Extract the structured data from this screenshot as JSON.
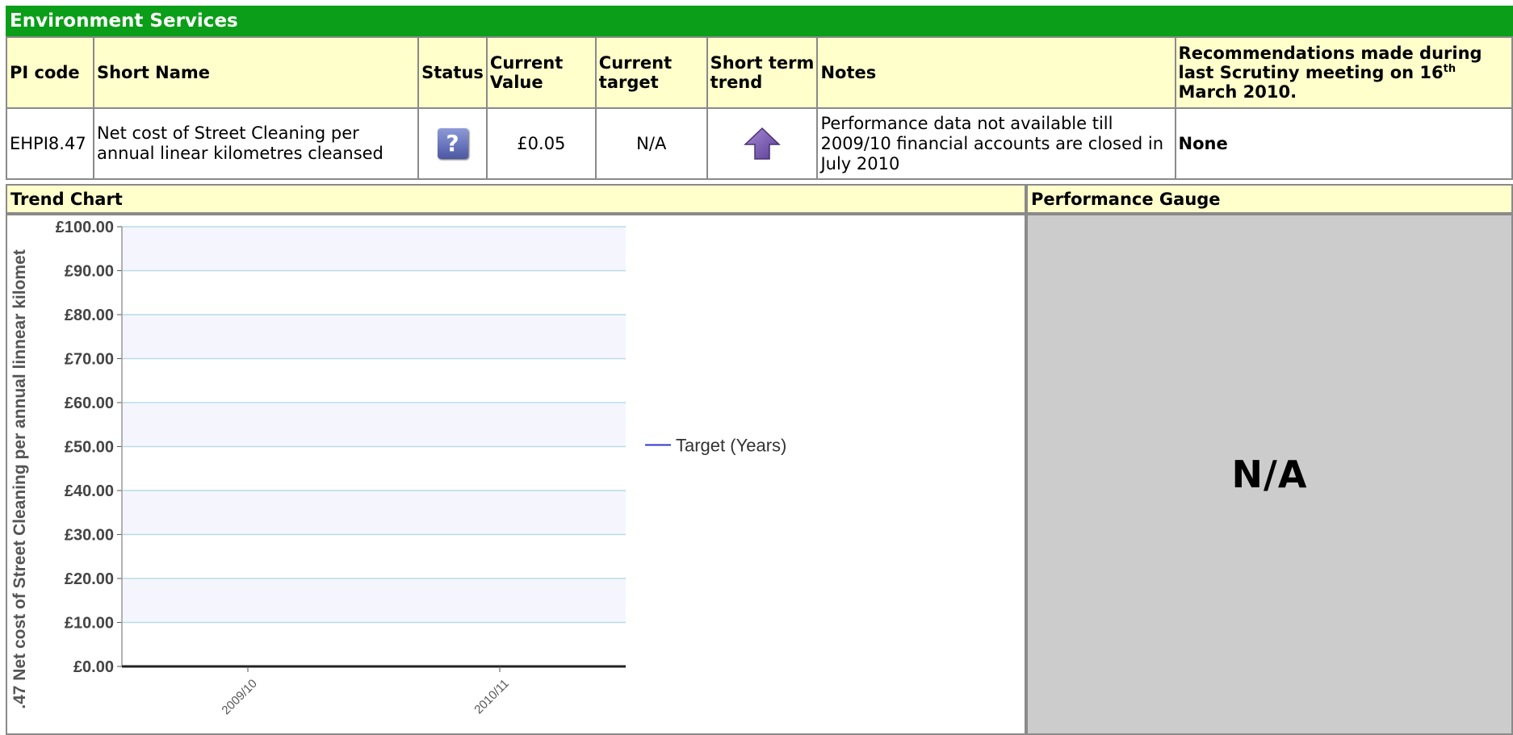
{
  "section_title": "Environment Services",
  "table": {
    "headers": {
      "pi_code": "PI code",
      "short_name": "Short Name",
      "status": "Status",
      "current_value": "Current Value",
      "current_target": "Current target",
      "short_term_trend": "Short term trend",
      "notes": "Notes",
      "recommendations": "Recommendations made during last Scrutiny meeting on 16",
      "recommendations_sup": "th",
      "recommendations_tail": "March 2010."
    },
    "row": {
      "pi_code": "EHPI8.47",
      "short_name": "Net cost of Street Cleaning per annual linear kilometres cleansed",
      "status_icon": "question-icon",
      "status_glyph": "?",
      "current_value": "£0.05",
      "current_target": "N/A",
      "trend_icon": "up-arrow-icon",
      "notes": "Performance data not available till 2009/10 financial accounts are closed in July 2010",
      "recommendations": "None"
    }
  },
  "trend_chart_label": "Trend Chart",
  "performance_gauge_label": "Performance Gauge",
  "gauge_value": "N/A",
  "colors": {
    "title_bar": "#0b9e18",
    "header_bg": "#ffffcc",
    "gauge_bg": "#cccccc",
    "series_line": "#3333cc",
    "gridline": "#b9dbe6"
  },
  "chart_data": {
    "type": "line",
    "title": "",
    "xlabel": "",
    "ylabel": ".47 Net cost of Street Cleaning per annual linnear kilomet",
    "categories": [
      "2009/10",
      "2010/11"
    ],
    "series": [
      {
        "name": "Target (Years)",
        "values": [
          null,
          null
        ]
      }
    ],
    "ylim": [
      0,
      100
    ],
    "yticks": [
      0,
      10,
      20,
      30,
      40,
      50,
      60,
      70,
      80,
      90,
      100
    ],
    "ytick_labels": [
      "£0.00",
      "£10.00",
      "£20.00",
      "£30.00",
      "£40.00",
      "£50.00",
      "£60.00",
      "£70.00",
      "£80.00",
      "£90.00",
      "£100.00"
    ],
    "grid": true,
    "legend": "right"
  }
}
